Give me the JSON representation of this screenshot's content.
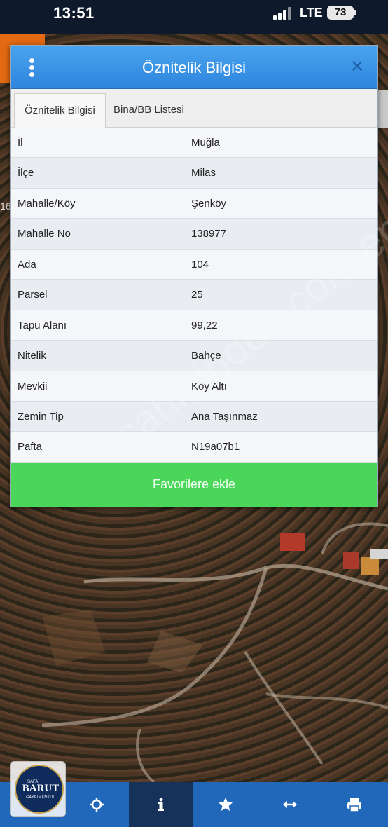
{
  "status_bar": {
    "time": "13:51",
    "network": "LTE",
    "battery": "73"
  },
  "map": {
    "label": "16"
  },
  "dialog": {
    "title": "Öznitelik Bilgisi",
    "close_icon": "close-icon",
    "menu_icon": "more-vertical-icon",
    "tabs": [
      {
        "label": "Öznitelik Bilgisi",
        "active": true
      },
      {
        "label": "Bina/BB Listesi",
        "active": false
      }
    ],
    "rows": [
      {
        "key": "İl",
        "value": "Muğla"
      },
      {
        "key": "İlçe",
        "value": "Milas"
      },
      {
        "key": "Mahalle/Köy",
        "value": "Şenköy"
      },
      {
        "key": "Mahalle No",
        "value": "138977"
      },
      {
        "key": "Ada",
        "value": "104"
      },
      {
        "key": "Parsel",
        "value": "25"
      },
      {
        "key": "Tapu Alanı",
        "value": "99,22"
      },
      {
        "key": "Nitelik",
        "value": "Bahçe"
      },
      {
        "key": "Mevkii",
        "value": "Köy Altı"
      },
      {
        "key": "Zemin Tip",
        "value": "Ana Taşınmaz"
      },
      {
        "key": "Pafta",
        "value": "N19a07b1"
      }
    ],
    "favorite_button": "Favorilere ekle"
  },
  "watermark": "sahibinden.com emlak",
  "logo": {
    "top": "SAFA",
    "main": "BARUT",
    "sub": "GAYRİMENKUL"
  },
  "toolbar": {
    "items": [
      {
        "icon": "locate-icon"
      },
      {
        "icon": "info-icon"
      },
      {
        "icon": "star-icon"
      },
      {
        "icon": "measure-arrows-icon"
      },
      {
        "icon": "print-icon"
      }
    ]
  },
  "colors": {
    "header_blue": "#2e86de",
    "button_green": "#4ad659",
    "toolbar_blue": "#2268ba",
    "toolbar_dark": "#16315a",
    "status_bar": "#0e1a2b"
  }
}
